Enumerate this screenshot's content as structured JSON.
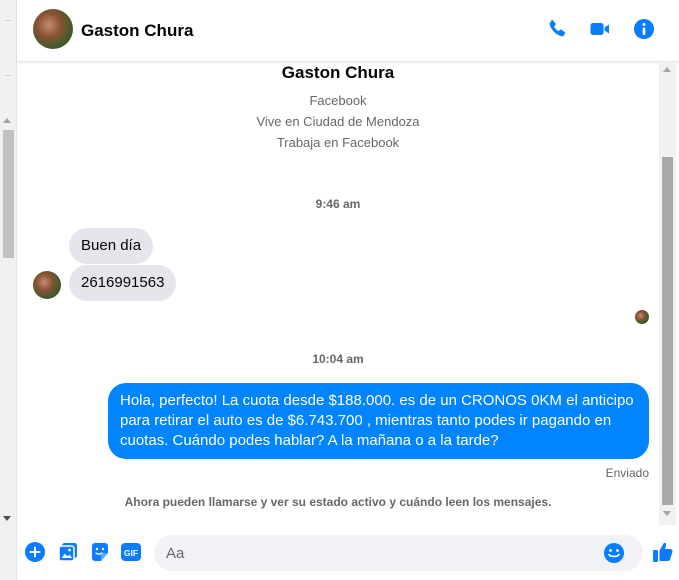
{
  "colors": {
    "accent": "#0084ff",
    "icon_blue": "#0a7cff",
    "incoming_bubble": "#e4e6eb",
    "secondary_text": "#65676b"
  },
  "header": {
    "name": "Gaston Chura",
    "icons": [
      "phone-icon",
      "video-camera-icon",
      "info-icon"
    ]
  },
  "profile": {
    "name": "Gaston Chura",
    "lines": [
      "Facebook",
      "Vive en Ciudad de Mendoza",
      "Trabaja en Facebook"
    ]
  },
  "messages": [
    {
      "type": "timestamp",
      "text": "9:46 am"
    },
    {
      "type": "incoming",
      "text": "Buen día"
    },
    {
      "type": "incoming",
      "text": "2616991563"
    },
    {
      "type": "timestamp",
      "text": "10:04 am"
    },
    {
      "type": "outgoing",
      "text": "Hola, perfecto! La cuota desde $188.000. es de un CRONOS 0KM el anticipo para retirar el auto es de $6.743.700 , mientras tanto podes ir pagando en cuotas. Cuándo podes hablar? A la mañana o a la tarde?"
    }
  ],
  "status": "Enviado",
  "notice": "Ahora pueden llamarse y ver su estado activo y cuándo leen los mensajes.",
  "composer": {
    "placeholder": "Aa",
    "value": "",
    "icons": [
      "plus-icon",
      "photo-icon",
      "sticker-icon",
      "gif-icon",
      "emoji-icon",
      "thumbs-up-icon"
    ],
    "gif_label": "GIF"
  }
}
